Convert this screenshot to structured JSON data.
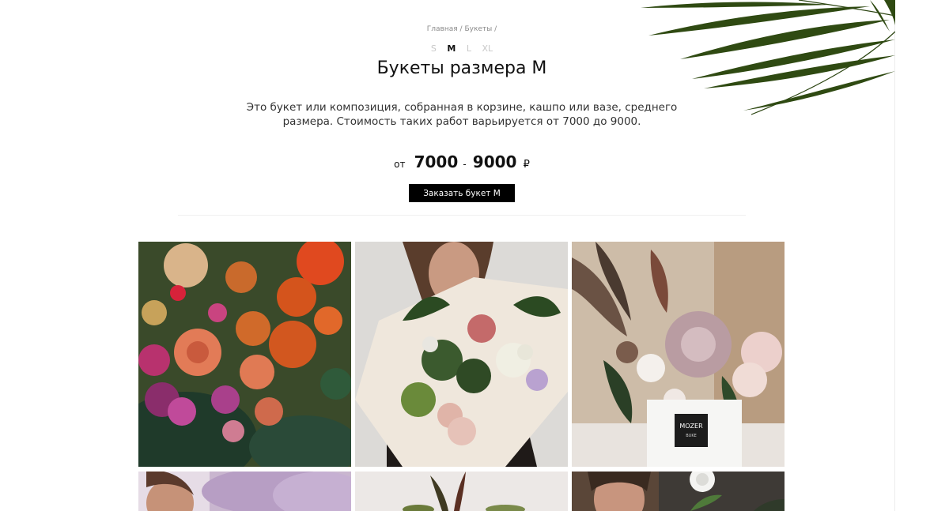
{
  "breadcrumb": {
    "home": "Главная",
    "bouquets": "Букеты",
    "separator": "/"
  },
  "sizes": [
    {
      "label": "S",
      "active": false
    },
    {
      "label": "M",
      "active": true
    },
    {
      "label": "L",
      "active": false
    },
    {
      "label": "XL",
      "active": false
    }
  ],
  "title": "Букеты размера М",
  "description": "Это букет или композиция, собранная в корзине, кашпо или вазе, среднего размера. Стоимость таких работ варьируется от 7000 до 9000.",
  "price": {
    "prefix": "от",
    "min": "7000",
    "dash": "-",
    "max": "9000",
    "currency": "₽"
  },
  "order_button": "Заказать букет М",
  "gallery": {
    "logo_text_line1": "MOZER",
    "logo_text_line2": "BUKE"
  },
  "colors": {
    "button_bg": "#000000",
    "leaf_green": "#2f4a12"
  }
}
